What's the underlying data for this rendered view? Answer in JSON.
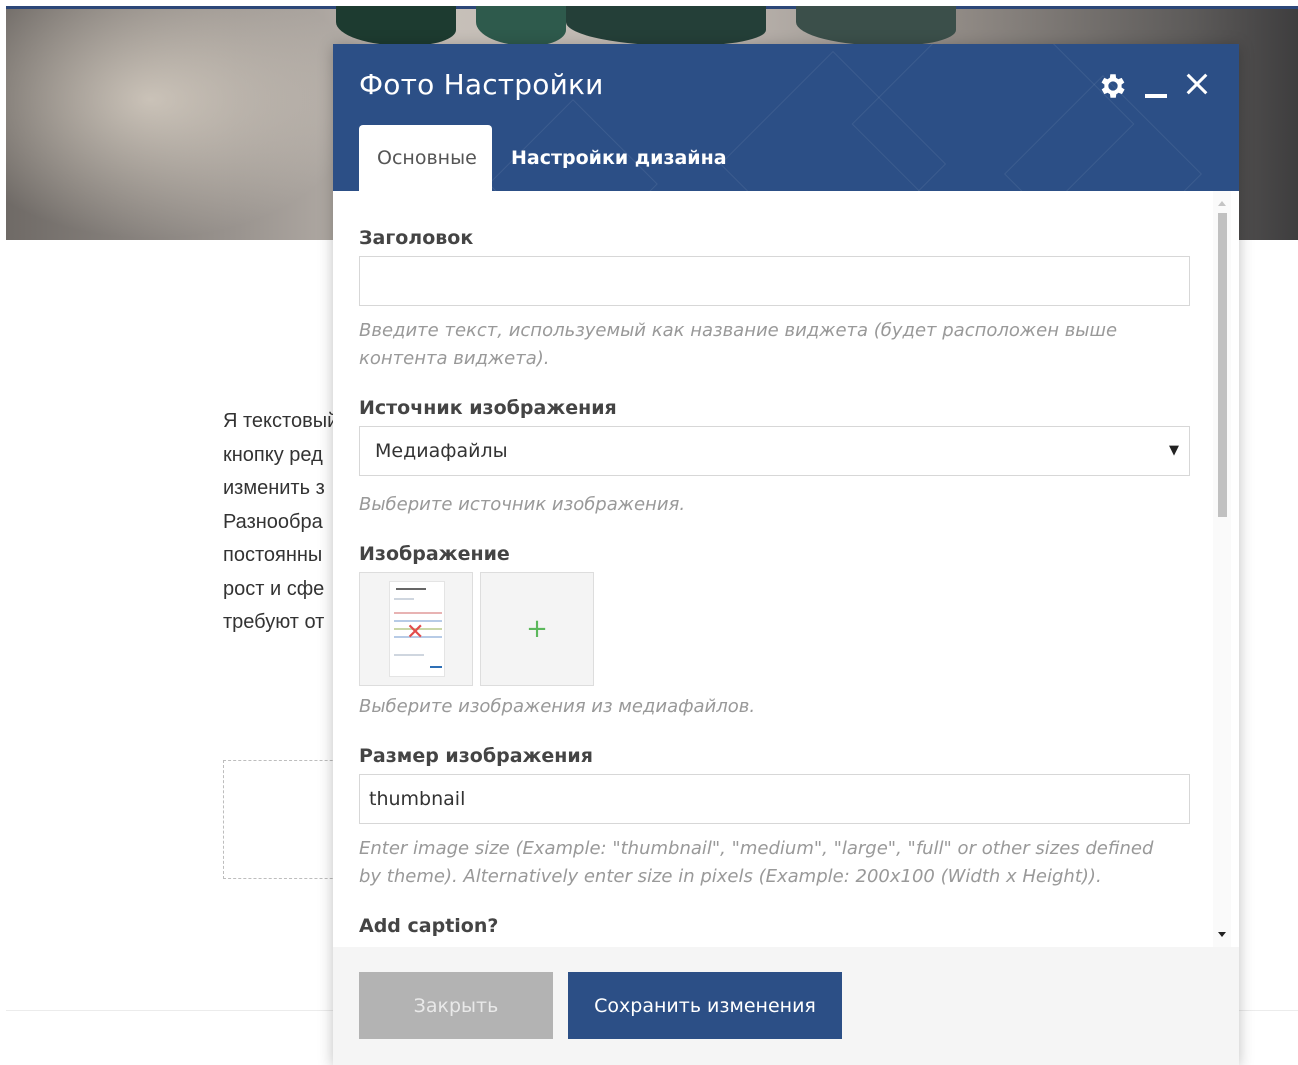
{
  "background": {
    "text_lines": [
      "Я текстовый",
      "кнопку ред",
      "изменить з",
      "Разнообра",
      "постоянны",
      "рост и сфе",
      "требуют от"
    ]
  },
  "dialog": {
    "title": "Фото Настройки",
    "header_icons": [
      "gear-icon",
      "minimize-icon",
      "close-icon"
    ],
    "tabs": [
      {
        "label": "Основные",
        "active": true
      },
      {
        "label": "Настройки дизайна",
        "active": false
      }
    ],
    "fields": {
      "title": {
        "label": "Заголовок",
        "value": "",
        "help": "Введите текст, используемый как название виджета (будет расположен выше контента виджета)."
      },
      "image_source": {
        "label": "Источник изображения",
        "value": "Медиафайлы",
        "help": "Выберите источник изображения."
      },
      "image": {
        "label": "Изображение",
        "add_symbol": "+",
        "remove_symbol": "✕",
        "help": "Выберите изображения из медиафайлов."
      },
      "image_size": {
        "label": "Размер изображения",
        "value": "thumbnail",
        "help": "Enter image size (Example: \"thumbnail\", \"medium\", \"large\", \"full\" or other sizes defined by theme). Alternatively enter size in pixels (Example: 200x100 (Width x Height))."
      },
      "caption": {
        "label": "Add caption?"
      }
    },
    "buttons": {
      "close_label": "Закрыть",
      "save_label": "Сохранить изменения"
    }
  },
  "colors": {
    "header": "#2c4f86",
    "save_button": "#2c4f86",
    "close_button": "#b3b3b3",
    "add_plus": "#5cb85c",
    "remove_x": "#e24c4c"
  }
}
